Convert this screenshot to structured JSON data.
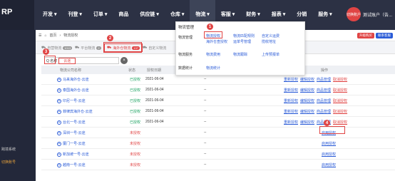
{
  "brand": "RP",
  "nav": [
    "开发",
    "刊登",
    "订单",
    "商品",
    "供应链",
    "仓库",
    "物流",
    "客服",
    "财务",
    "报表",
    "分销",
    "服务"
  ],
  "user": {
    "avatar": "切换账户",
    "name": "测试账户（告..."
  },
  "sidebar": {
    "item1": "跨境系统",
    "item2": "切换账号"
  },
  "breadcrumb": {
    "home": "首页",
    "current": "物流授权"
  },
  "top_buttons": {
    "upgrade": "升级购买",
    "contact": "联系客服"
  },
  "tabs": [
    {
      "label": "自营物流",
      "count": "1013"
    },
    {
      "label": "平台物流",
      "count": "2"
    },
    {
      "label": "海外仓物流",
      "count": "137"
    },
    {
      "label": "自定义物流",
      "count": ""
    }
  ],
  "search": {
    "prefix": "Q 名称",
    "value": "云途"
  },
  "table": {
    "headers": [
      "物流公司名称",
      "状态",
      "授权日期",
      "备注",
      "操作"
    ],
    "rows": [
      {
        "name": "马来海外仓-云途",
        "status": "已授权",
        "date": "2021-06-04",
        "note": "--",
        "actions": [
          "重新授权",
          "编辑授权",
          "商品管理",
          "取消授权"
        ]
      },
      {
        "name": "泰国海外仓-云途",
        "status": "已授权",
        "date": "2021-06-04",
        "note": "--",
        "actions": [
          "重新授权",
          "编辑授权",
          "商品管理",
          "取消授权"
        ]
      },
      {
        "name": "印尼一号-云途",
        "status": "已授权",
        "date": "2021-06-04",
        "note": "--",
        "actions": [
          "重新授权",
          "编辑授权",
          "商品管理",
          "取消授权"
        ]
      },
      {
        "name": "菲律宾海外仓-云途",
        "status": "已授权",
        "date": "2021-06-04",
        "note": "--",
        "actions": [
          "重新授权",
          "编辑授权",
          "商品管理",
          "取消授权"
        ]
      },
      {
        "name": "台北一号-云途",
        "status": "已授权",
        "date": "2021-06-04",
        "note": "--",
        "actions": [
          "重新授权",
          "编辑授权",
          "商品管理",
          "取消授权"
        ]
      },
      {
        "name": "深圳一号-云途",
        "status": "未授权",
        "date": "",
        "note": "--",
        "actions": [
          "启用授权"
        ]
      },
      {
        "name": "厦门一号-云途",
        "status": "未授权",
        "date": "",
        "note": "--",
        "actions": [
          "启用授权"
        ]
      },
      {
        "name": "新加坡一号-云途",
        "status": "未授权",
        "date": "",
        "note": "--",
        "actions": [
          "启用授权"
        ]
      },
      {
        "name": "越南一号-云途",
        "status": "未授权",
        "date": "",
        "note": "--",
        "actions": [
          "启用授权"
        ]
      }
    ]
  },
  "dropdown": {
    "title": "物流管理",
    "groups": [
      {
        "label": "物流管理",
        "links": [
          "物流授权",
          "物流匹配规则",
          "自定义运费",
          "海外仓查授权",
          "运单号管理",
          "揽收地址"
        ]
      },
      {
        "label": "物流服务",
        "links": [
          "物流费用",
          "物流跟踪",
          "上传预报单"
        ]
      },
      {
        "label": "数据统计",
        "links": [
          "物流统计"
        ]
      }
    ]
  },
  "markers": [
    "1",
    "2",
    "3",
    "4"
  ],
  "colors": {
    "accent": "#e04444",
    "nav_bg": "#2c3144",
    "link": "#2a5bd7",
    "enabled": "#19a15f"
  }
}
